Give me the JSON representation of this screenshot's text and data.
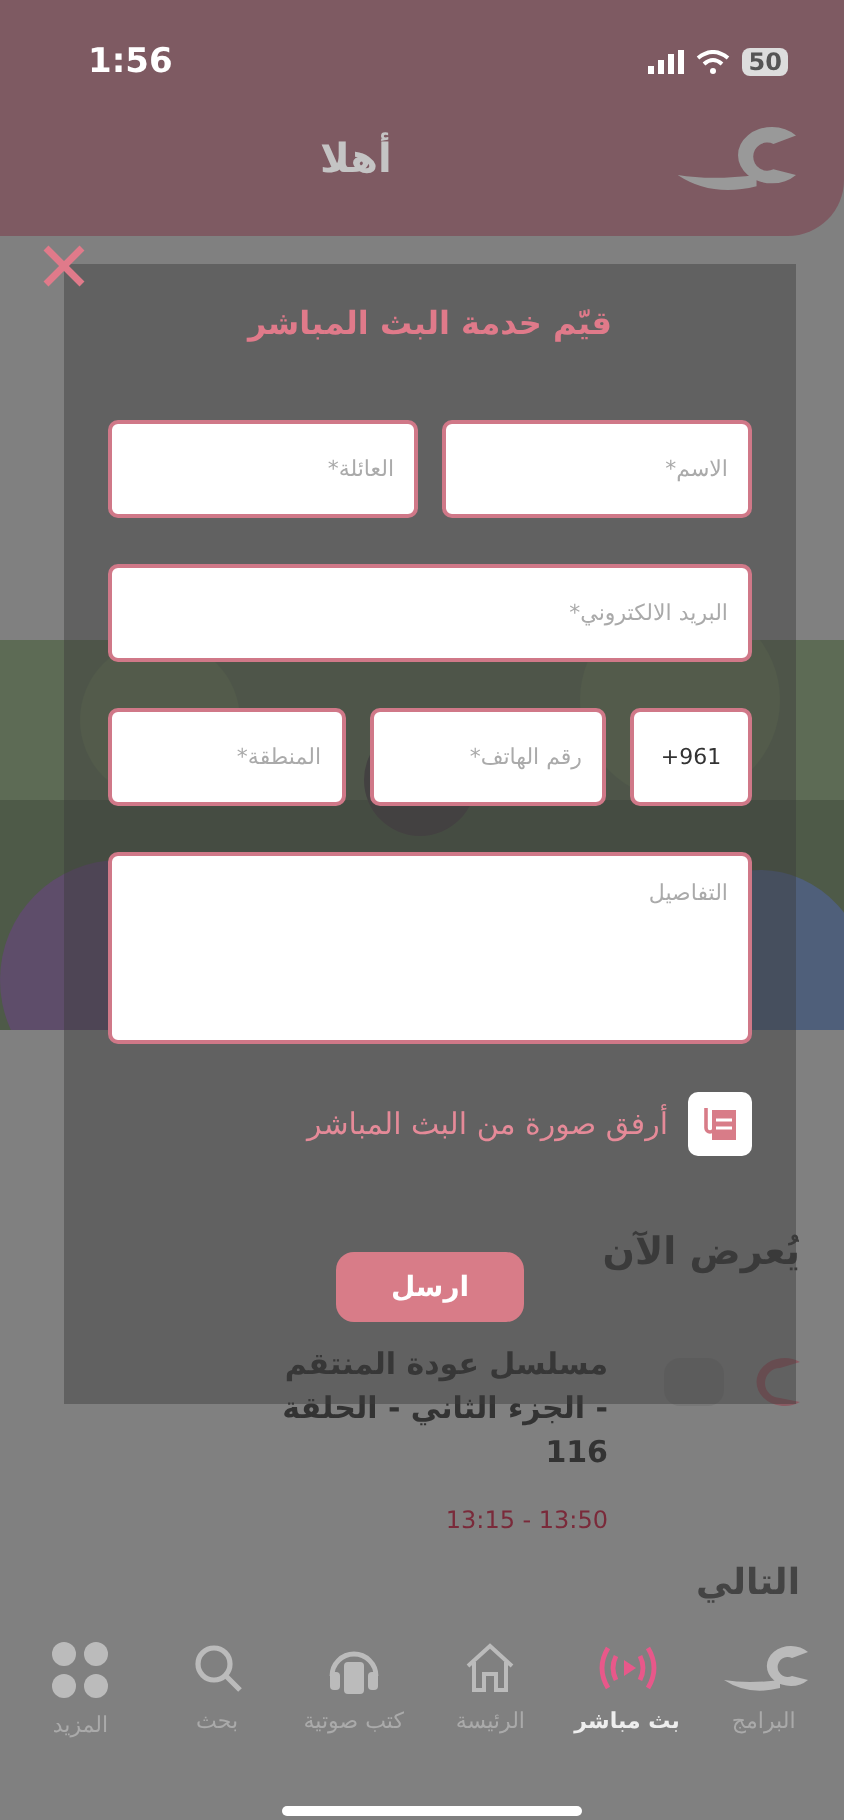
{
  "status_bar": {
    "time": "1:56",
    "battery": "50"
  },
  "header": {
    "title": "أهلا"
  },
  "live_section": {
    "title": "يُعرض الآن",
    "program": {
      "title": "مسلسل عودة المنتقم - الجزء الثاني - الحلقة 116",
      "time": "13:15 - 13:50"
    }
  },
  "next_section": {
    "title": "التالي"
  },
  "tab_bar": [
    {
      "label": "البرامج",
      "kind": "logo",
      "selected": false
    },
    {
      "label": "بث مباشر",
      "kind": "live",
      "selected": true
    },
    {
      "label": "الرئيسة",
      "kind": "home",
      "selected": false
    },
    {
      "label": "كتب صوتية",
      "kind": "audiobook",
      "selected": false
    },
    {
      "label": "بحث",
      "kind": "search",
      "selected": false
    },
    {
      "label": "المزيد",
      "kind": "more",
      "selected": false
    }
  ],
  "modal": {
    "title": "قيّم خدمة البث المباشر",
    "rows": [
      [
        {
          "placeholder": "الاسم*"
        },
        {
          "placeholder": "العائلة*"
        }
      ],
      [
        {
          "placeholder": "البريد الالكتروني*"
        }
      ],
      [
        {
          "value": "+961",
          "kind": "code"
        },
        {
          "placeholder": "رقم الهاتف*"
        },
        {
          "placeholder": "المنطقة*"
        }
      ]
    ],
    "details": {
      "placeholder": "التفاصيل"
    },
    "attach": {
      "label": "أرفق صورة من البث المباشر"
    },
    "submit": "ارسل"
  }
}
